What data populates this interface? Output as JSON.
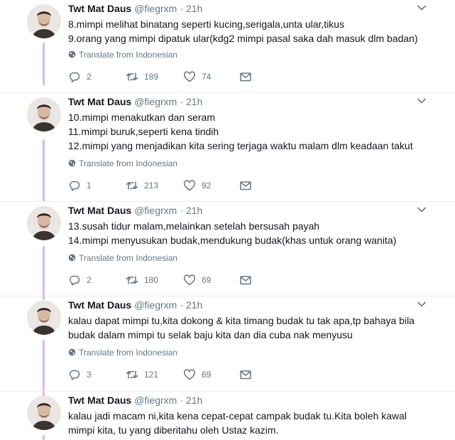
{
  "author": {
    "name": "Twt Mat Daus",
    "handle": "@fiegrxm",
    "time": "21h"
  },
  "translate_label": "Translate from Indonesian",
  "tweets": [
    {
      "lines": [
        "8.mimpi melihat binatang seperti kucing,serigala,unta ular,tikus",
        "9.orang yang mimpi dipatuk ular(kdg2 mimpi pasal saka dah masuk dlm badan)"
      ],
      "replies": "2",
      "retweets": "189",
      "likes": "74"
    },
    {
      "lines": [
        "10.mimpi menakutkan dan seram",
        "11.mimpi buruk,seperti kena tindih",
        "12.mimpi yang menjadikan kita sering terjaga waktu malam dlm keadaan takut"
      ],
      "replies": "1",
      "retweets": "213",
      "likes": "92"
    },
    {
      "lines": [
        "13.susah tidur malam,melainkan setelah bersusah payah",
        "14.mimpi menyusukan budak,mendukung budak(khas untuk orang wanita)"
      ],
      "replies": "2",
      "retweets": "180",
      "likes": "69"
    },
    {
      "lines": [
        "kalau dapat mimpi tu,kita dokong & kita timang budak tu tak apa,tp bahaya bila",
        "budak dalam mimpi tu selak baju kita dan dia cuba nak menyusu"
      ],
      "replies": "3",
      "retweets": "121",
      "likes": "69"
    },
    {
      "lines": [
        "kalau jadi macam ni,kita kena cepat-cepat campak budak tu.Kita boleh kawal",
        "mimpi kita, tu yang diberitahu oleh Ustaz kazim."
      ]
    }
  ],
  "icons": {
    "reply": "reply-icon",
    "retweet": "retweet-icon",
    "like": "heart-icon",
    "message": "envelope-icon",
    "translate": "globe-icon",
    "caret": "chevron-down-icon"
  },
  "colors": {
    "thread_line": "#d7b9ea",
    "muted": "#657786",
    "text": "#14171a"
  }
}
